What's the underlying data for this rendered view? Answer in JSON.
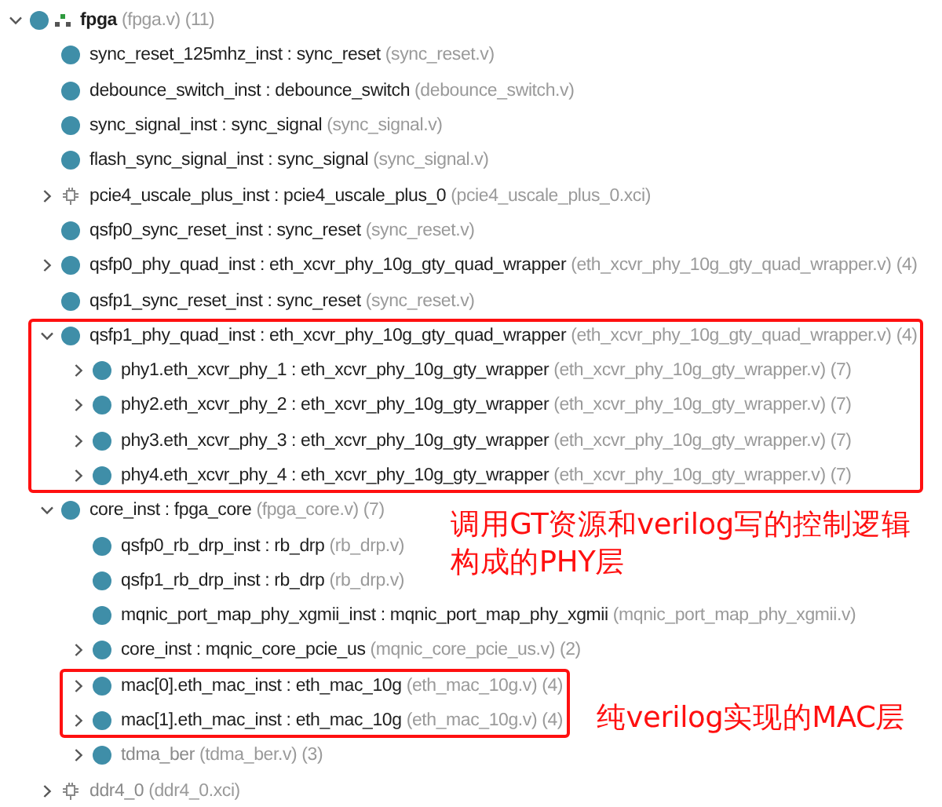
{
  "tree": [
    {
      "instance": "fpga",
      "file": "(fpga.v)",
      "count": "(11)",
      "kind": "top",
      "expanded": true,
      "disabled": false,
      "boxed": false,
      "children": [
        {
          "instance": "sync_reset_125mhz_inst",
          "sep": ":",
          "module": "sync_reset",
          "file": "(sync_reset.v)",
          "kind": "module",
          "disabled": false,
          "boxed": false
        },
        {
          "instance": "debounce_switch_inst",
          "sep": ":",
          "module": "debounce_switch",
          "file": "(debounce_switch.v)",
          "kind": "module",
          "disabled": false,
          "boxed": false
        },
        {
          "instance": "sync_signal_inst",
          "sep": ":",
          "module": "sync_signal",
          "file": "(sync_signal.v)",
          "kind": "module",
          "disabled": false,
          "boxed": false
        },
        {
          "instance": "flash_sync_signal_inst",
          "sep": ":",
          "module": "sync_signal",
          "file": "(sync_signal.v)",
          "kind": "module",
          "disabled": false,
          "boxed": false
        },
        {
          "instance": "pcie4_uscale_plus_inst",
          "sep": ":",
          "module": "pcie4_uscale_plus_0",
          "file": "(pcie4_uscale_plus_0.xci)",
          "kind": "ip",
          "expanded": false,
          "disabled": false,
          "boxed": false
        },
        {
          "instance": "qsfp0_sync_reset_inst",
          "sep": ":",
          "module": "sync_reset",
          "file": "(sync_reset.v)",
          "kind": "module",
          "disabled": false,
          "boxed": false
        },
        {
          "instance": "qsfp0_phy_quad_inst",
          "sep": ":",
          "module": "eth_xcvr_phy_10g_gty_quad_wrapper",
          "file": "(eth_xcvr_phy_10g_gty_quad_wrapper.v)",
          "count": "(4)",
          "kind": "module",
          "expanded": false,
          "disabled": false,
          "boxed": false
        },
        {
          "instance": "qsfp1_sync_reset_inst",
          "sep": ":",
          "module": "sync_reset",
          "file": "(sync_reset.v)",
          "kind": "module",
          "disabled": false,
          "boxed": false
        },
        {
          "instance": "qsfp1_phy_quad_inst",
          "sep": ":",
          "module": "eth_xcvr_phy_10g_gty_quad_wrapper",
          "file": "(eth_xcvr_phy_10g_gty_quad_wrapper.v)",
          "count": "(4)",
          "kind": "module",
          "expanded": true,
          "disabled": false,
          "boxed": true,
          "children": [
            {
              "instance": "phy1.eth_xcvr_phy_1",
              "sep": ":",
              "module": "eth_xcvr_phy_10g_gty_wrapper",
              "file": "(eth_xcvr_phy_10g_gty_wrapper.v)",
              "count": "(7)",
              "kind": "module",
              "expanded": false,
              "disabled": false,
              "boxed": true
            },
            {
              "instance": "phy2.eth_xcvr_phy_2",
              "sep": ":",
              "module": "eth_xcvr_phy_10g_gty_wrapper",
              "file": "(eth_xcvr_phy_10g_gty_wrapper.v)",
              "count": "(7)",
              "kind": "module",
              "expanded": false,
              "disabled": false,
              "boxed": true
            },
            {
              "instance": "phy3.eth_xcvr_phy_3",
              "sep": ":",
              "module": "eth_xcvr_phy_10g_gty_wrapper",
              "file": "(eth_xcvr_phy_10g_gty_wrapper.v)",
              "count": "(7)",
              "kind": "module",
              "expanded": false,
              "disabled": false,
              "boxed": true
            },
            {
              "instance": "phy4.eth_xcvr_phy_4",
              "sep": ":",
              "module": "eth_xcvr_phy_10g_gty_wrapper",
              "file": "(eth_xcvr_phy_10g_gty_wrapper.v)",
              "count": "(7)",
              "kind": "module",
              "expanded": false,
              "disabled": false,
              "boxed": true
            }
          ]
        },
        {
          "instance": "core_inst",
          "sep": ":",
          "module": "fpga_core",
          "file": "(fpga_core.v)",
          "count": "(7)",
          "kind": "module",
          "expanded": true,
          "disabled": false,
          "boxed": false,
          "children": [
            {
              "instance": "qsfp0_rb_drp_inst",
              "sep": ":",
              "module": "rb_drp",
              "file": "(rb_drp.v)",
              "kind": "module",
              "disabled": false,
              "boxed": false
            },
            {
              "instance": "qsfp1_rb_drp_inst",
              "sep": ":",
              "module": "rb_drp",
              "file": "(rb_drp.v)",
              "kind": "module",
              "disabled": false,
              "boxed": false
            },
            {
              "instance": "mqnic_port_map_phy_xgmii_inst",
              "sep": ":",
              "module": "mqnic_port_map_phy_xgmii",
              "file": "(mqnic_port_map_phy_xgmii.v)",
              "kind": "module",
              "disabled": false,
              "boxed": false
            },
            {
              "instance": "core_inst",
              "sep": ":",
              "module": "mqnic_core_pcie_us",
              "file": "(mqnic_core_pcie_us.v)",
              "count": "(2)",
              "kind": "module",
              "expanded": false,
              "disabled": false,
              "boxed": false
            },
            {
              "instance": "mac[0].eth_mac_inst",
              "sep": ":",
              "module": "eth_mac_10g",
              "file": "(eth_mac_10g.v)",
              "count": "(4)",
              "kind": "module",
              "expanded": false,
              "disabled": false,
              "boxed": true
            },
            {
              "instance": "mac[1].eth_mac_inst",
              "sep": ":",
              "module": "eth_mac_10g",
              "file": "(eth_mac_10g.v)",
              "count": "(4)",
              "kind": "module",
              "expanded": false,
              "disabled": false,
              "boxed": true
            },
            {
              "instance": "tdma_ber",
              "file": "(tdma_ber.v)",
              "count": "(3)",
              "kind": "module",
              "expanded": false,
              "disabled": true,
              "boxed": false
            }
          ]
        },
        {
          "instance": "ddr4_0",
          "file": "(ddr4_0.xci)",
          "kind": "ip",
          "expanded": false,
          "disabled": true,
          "boxed": false
        }
      ]
    }
  ],
  "annotations": [
    {
      "text": "调用GT资源和verilog写的控制逻辑构成的PHY层"
    },
    {
      "text": "纯verilog实现的MAC层"
    }
  ]
}
